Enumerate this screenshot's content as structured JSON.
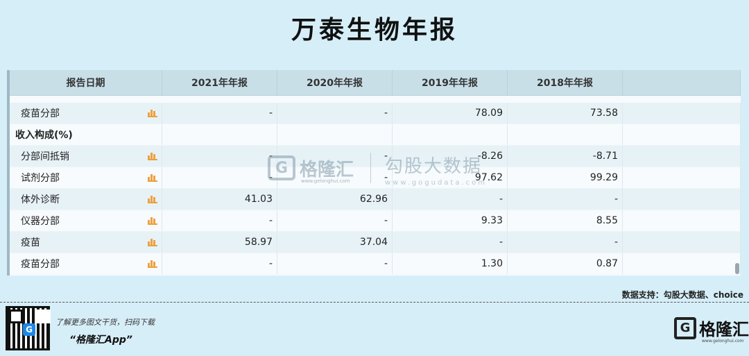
{
  "title": "万泰生物年报",
  "table": {
    "headers": [
      "报告日期",
      "2021年年报",
      "2020年年报",
      "2019年年报",
      "2018年年报",
      ""
    ],
    "rows": [
      {
        "label": "疫苗分部",
        "section": false,
        "chart_icon": true,
        "values": [
          "-",
          "-",
          "78.09",
          "73.58"
        ]
      },
      {
        "label": "收入构成(%)",
        "section": true,
        "chart_icon": false,
        "values": [
          "",
          "",
          "",
          ""
        ]
      },
      {
        "label": "分部间抵销",
        "section": false,
        "chart_icon": true,
        "values": [
          "-",
          "-",
          "-8.26",
          "-8.71"
        ]
      },
      {
        "label": "试剂分部",
        "section": false,
        "chart_icon": true,
        "values": [
          "-",
          "-",
          "97.62",
          "99.29"
        ]
      },
      {
        "label": "体外诊断",
        "section": false,
        "chart_icon": true,
        "values": [
          "41.03",
          "62.96",
          "-",
          "-"
        ]
      },
      {
        "label": "仪器分部",
        "section": false,
        "chart_icon": true,
        "values": [
          "-",
          "-",
          "9.33",
          "8.55"
        ]
      },
      {
        "label": "疫苗",
        "section": false,
        "chart_icon": true,
        "values": [
          "58.97",
          "37.04",
          "-",
          "-"
        ]
      },
      {
        "label": "疫苗分部",
        "section": false,
        "chart_icon": true,
        "values": [
          "-",
          "-",
          "1.30",
          "0.87"
        ]
      }
    ]
  },
  "watermark": {
    "brand": "格隆汇",
    "brand_url": "www.gelonghui.com",
    "partner": "勾股大数据",
    "partner_url": "www.gogudata.com"
  },
  "source_note": "数据支持：勾股大数据、choice",
  "footer": {
    "promo_line": "了解更多图文干货，扫码下载",
    "app_name": "“格隆汇App”",
    "brand": "格隆汇",
    "brand_url": "www.gelonghui.com",
    "qr_center": "G"
  },
  "icons": {
    "row_chart": "bar-chart-icon",
    "qr": "qr-code-icon",
    "logo": "gelonghui-logo-icon"
  },
  "colors": {
    "background": "#d6eef8",
    "header": "#c9dfe8",
    "accent_icon": "#f0a040"
  }
}
